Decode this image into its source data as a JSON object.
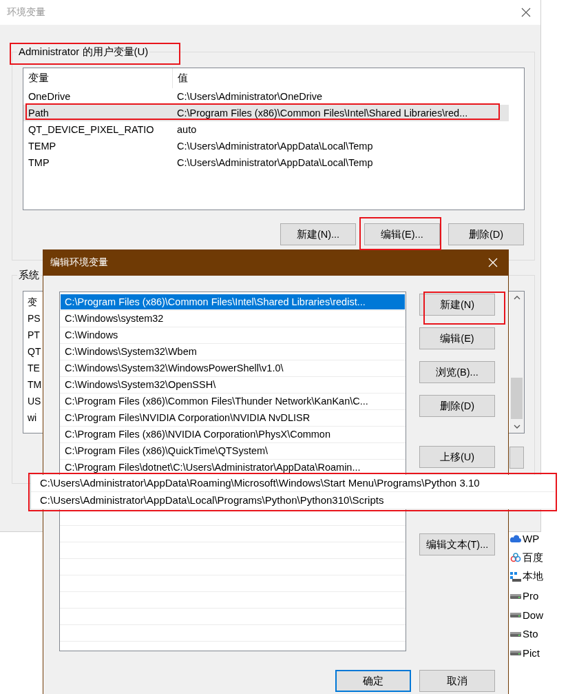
{
  "main_window": {
    "title": "环境变量",
    "user_group": {
      "label": "Administrator 的用户变量(U)",
      "columns": [
        "变量",
        "值"
      ],
      "rows": [
        {
          "name": "OneDrive",
          "value": "C:\\Users\\Administrator\\OneDrive",
          "selected": false
        },
        {
          "name": "Path",
          "value": "C:\\Program Files (x86)\\Common Files\\Intel\\Shared Libraries\\red...",
          "selected": true
        },
        {
          "name": "QT_DEVICE_PIXEL_RATIO",
          "value": "auto",
          "selected": false
        },
        {
          "name": "TEMP",
          "value": "C:\\Users\\Administrator\\AppData\\Local\\Temp",
          "selected": false
        },
        {
          "name": "TMP",
          "value": "C:\\Users\\Administrator\\AppData\\Local\\Temp",
          "selected": false
        }
      ],
      "buttons": [
        "新建(N)...",
        "编辑(E)...",
        "删除(D)"
      ]
    },
    "system_group": {
      "label": "系统",
      "rows": [
        "变",
        "PS",
        "PT",
        "QT",
        "TE",
        "TM",
        "US",
        "wi"
      ]
    }
  },
  "edit_dialog": {
    "title": "编辑环境变量",
    "entries": [
      {
        "text": "C:\\Program Files (x86)\\Common Files\\Intel\\Shared Libraries\\redist...",
        "selected": true
      },
      {
        "text": "C:\\Windows\\system32",
        "selected": false
      },
      {
        "text": "C:\\Windows",
        "selected": false
      },
      {
        "text": "C:\\Windows\\System32\\Wbem",
        "selected": false
      },
      {
        "text": "C:\\Windows\\System32\\WindowsPowerShell\\v1.0\\",
        "selected": false
      },
      {
        "text": "C:\\Windows\\System32\\OpenSSH\\",
        "selected": false
      },
      {
        "text": "C:\\Program Files (x86)\\Common Files\\Thunder Network\\KanKan\\C...",
        "selected": false
      },
      {
        "text": "C:\\Program Files\\NVIDIA Corporation\\NVIDIA NvDLISR",
        "selected": false
      },
      {
        "text": "C:\\Program Files (x86)\\NVIDIA Corporation\\PhysX\\Common",
        "selected": false
      },
      {
        "text": "C:\\Program Files (x86)\\QuickTime\\QTSystem\\",
        "selected": false
      },
      {
        "text": "C:\\Program Files\\dotnet\\C:\\Users\\Administrator\\AppData\\Roamin...",
        "selected": false
      }
    ],
    "buttons": [
      "新建(N)",
      "编辑(E)",
      "浏览(B)...",
      "删除(D)",
      "上移(U)",
      "编辑文本(T)..."
    ],
    "ok": "确定",
    "cancel": "取消"
  },
  "pasted_entries": [
    "C:\\Users\\Administrator\\AppData\\Roaming\\Microsoft\\Windows\\Start Menu\\Programs\\Python 3.10",
    "C:\\Users\\Administrator\\AppData\\Local\\Programs\\Python\\Python310\\Scripts"
  ],
  "background_items": [
    {
      "label": "WP",
      "kind": "cloud"
    },
    {
      "label": "百度",
      "kind": "baidu"
    },
    {
      "label": "本地",
      "kind": "grid"
    },
    {
      "label": "Pro",
      "kind": "drive"
    },
    {
      "label": "Dow",
      "kind": "drive"
    },
    {
      "label": "Sto",
      "kind": "drive"
    },
    {
      "label": "Pict",
      "kind": "drive"
    }
  ]
}
